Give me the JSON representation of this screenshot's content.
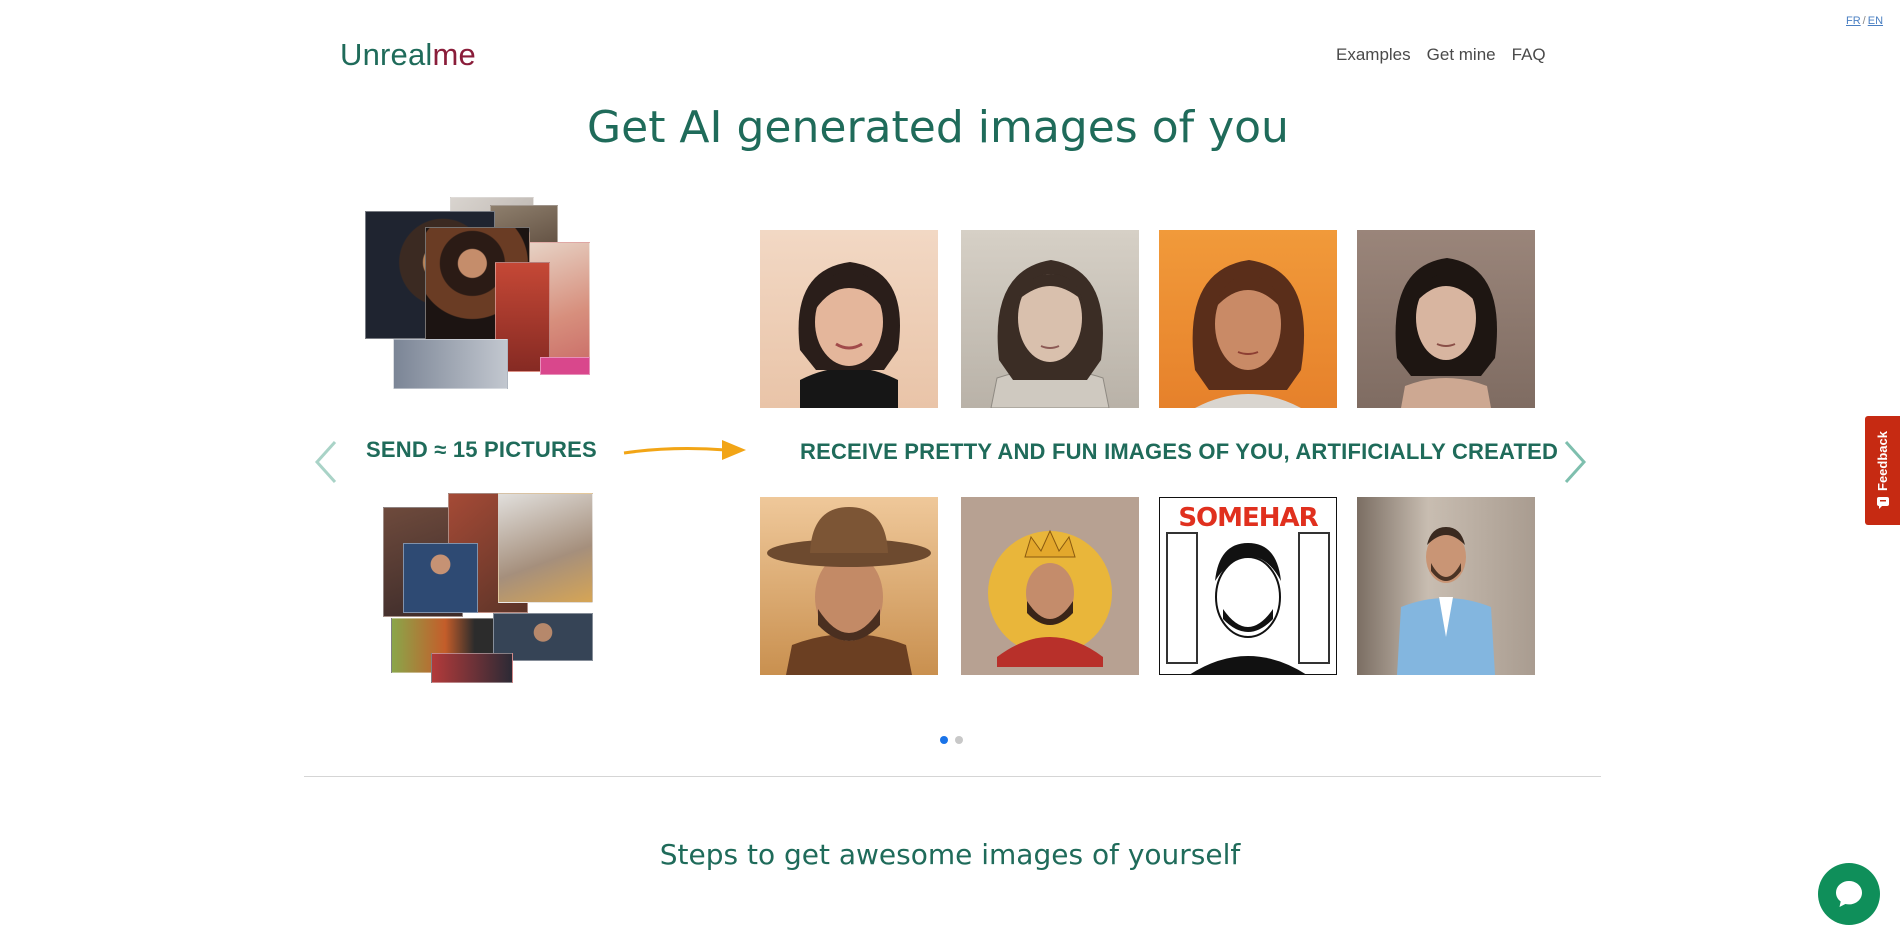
{
  "lang": {
    "fr": "FR",
    "sep": "/",
    "en": "EN"
  },
  "logo": {
    "part1": "Unreal",
    "part2": "me"
  },
  "nav": [
    {
      "label": "Examples"
    },
    {
      "label": "Get mine"
    },
    {
      "label": "FAQ"
    }
  ],
  "hero": {
    "title": "Get AI generated images of you"
  },
  "carousel": {
    "send_label": "SEND ≈ 15 PICTURES",
    "receive_label": "RECEIVE PRETTY AND FUN IMAGES OF YOU, ARTIFICIALLY CREATED",
    "portrait_text": "SOMEHAR",
    "slides": 2,
    "active_slide": 1
  },
  "steps": {
    "title": "Steps to get awesome images of yourself"
  },
  "feedback": {
    "label": "Feedback"
  },
  "colors": {
    "brand_green": "#1f6b5a",
    "brand_red": "#8a1d3a",
    "arrow_orange": "#f2a516",
    "feedback_red": "#c62a12",
    "chat_green": "#0f8f5a",
    "dot_active": "#1a73e8"
  },
  "icons": [
    "chevron-left-icon",
    "chevron-right-icon",
    "arrow-right-icon",
    "feedback-icon",
    "chat-icon"
  ]
}
